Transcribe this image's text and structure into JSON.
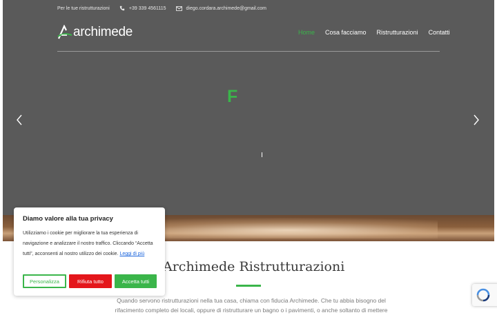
{
  "topbar": {
    "tagline": "Per le tue ristrutturazioni",
    "phone": "+39 339 4561115",
    "email": "diego.cordara.archimede@gmail.com"
  },
  "brand": {
    "name": "archimede",
    "accent": "#3ab54a"
  },
  "nav": {
    "items": [
      {
        "label": "Home",
        "active": true
      },
      {
        "label": "Cosa facciamo",
        "active": false
      },
      {
        "label": "Ristrutturazioni",
        "active": false
      },
      {
        "label": "Contatti",
        "active": false
      }
    ]
  },
  "hero": {
    "headline_letter": "F",
    "cursor_text": "I"
  },
  "main": {
    "title": "Archimede Ristrutturazioni",
    "intro": "Quando servono ristrutturazioni nella tua casa, chiama con fiducia Archimede. Che tu abbia bisogno del rifacimento completo dei locali, oppure di ristrutturare un bagno o i pavimenti, o anche soltanto di mettere"
  },
  "cookie_banner": {
    "title": "Diamo valore alla tua privacy",
    "text": "Utilizziamo i cookie per migliorare la tua esperienza di navigazione e analizzare il nostro traffico. Cliccando “Accetta tutti”, acconsenti al nostro utilizzo dei cookie.",
    "link_label": "Leggi di più",
    "buttons": {
      "customize": "Personalizza",
      "reject": "Rifiuta tutto",
      "accept": "Accetta tutti"
    },
    "colors": {
      "reject": "#e4161b",
      "accept": "#3ab54a",
      "link": "#1863dc"
    }
  }
}
